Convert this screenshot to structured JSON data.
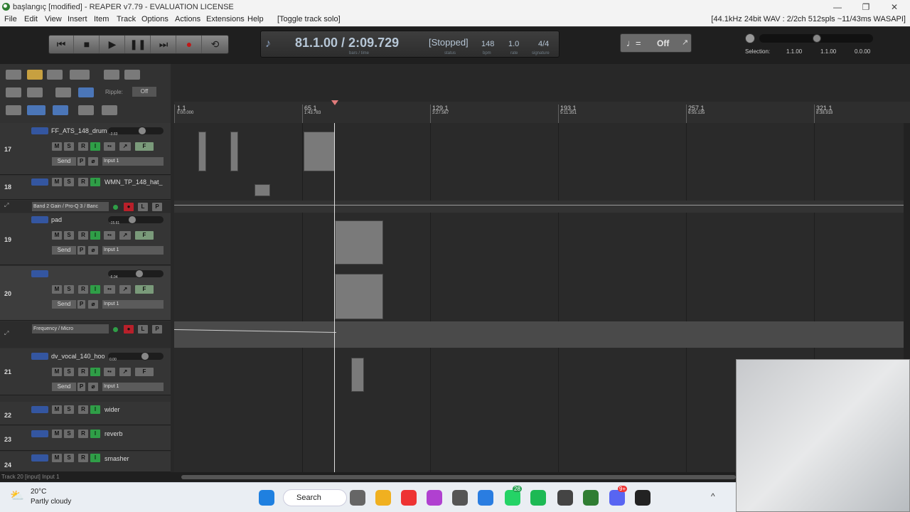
{
  "window": {
    "title": "başlangıç [modified] - REAPER v7.79 - EVALUATION LICENSE"
  },
  "menu": {
    "items": [
      "File",
      "Edit",
      "View",
      "Insert",
      "Item",
      "Track",
      "Options",
      "Actions",
      "Extensions",
      "Help"
    ],
    "action_hint": "[Toggle track solo]",
    "audio_info": "[44.1kHz 24bit WAV : 2/2ch 512spls ~11/43ms WASAPI]"
  },
  "transport": {
    "position": "81.1.00 / 2:09.729",
    "position_sub": "bars / time",
    "status": "[Stopped]",
    "status_sub": "status",
    "bpm": "148",
    "bpm_sub": "bpm",
    "rate": "1.0",
    "rate_sub": "rate",
    "signature": "4/4",
    "signature_sub": "signature",
    "metronome": "Off",
    "selection_label": "Selection:",
    "sel_start": "1.1.00",
    "sel_end": "1.1.00",
    "sel_len": "0.0.00",
    "ripple_label": "Ripple:",
    "ripple_value": "Off"
  },
  "ruler": [
    {
      "bar": "1.1",
      "time": "0:00.000"
    },
    {
      "bar": "65.1",
      "time": "1:43.783"
    },
    {
      "bar": "129.1",
      "time": "3:27.567"
    },
    {
      "bar": "193.1",
      "time": "5:11.351"
    },
    {
      "bar": "257.1",
      "time": "6:55.135"
    },
    {
      "bar": "321.1",
      "time": "8:38.918"
    }
  ],
  "tracks": [
    {
      "num": "17",
      "name": "FF_ATS_148_drum",
      "vol": "-3.63",
      "input": "Input 1"
    },
    {
      "num": "18",
      "name": "WMN_TP_148_hat_"
    },
    {
      "envelope": "Band 2 Gain / Pro-Q 3 / Banc"
    },
    {
      "num": "19",
      "name": "pad",
      "vol": "-15.61",
      "input": "Input 1"
    },
    {
      "num": "20",
      "name": "",
      "vol": "-6.04",
      "input": "Input 1"
    },
    {
      "envelope": "Frequency / Micro"
    },
    {
      "num": "21",
      "name": "dv_vocal_140_hoo",
      "vol": "0.00",
      "input": "Input 1"
    },
    {
      "num": "22",
      "name": "wider"
    },
    {
      "num": "23",
      "name": "reverb"
    },
    {
      "num": "24",
      "name": "smasher"
    }
  ],
  "labels": {
    "mute": "M",
    "solo": "S",
    "route": "R",
    "input_mon": "I",
    "send": "Send",
    "p": "P",
    "fx": "F",
    "env_l": "L",
    "env_p": "P"
  },
  "statusbar": "Track 20 [input] Input 1",
  "taskbar": {
    "temp": "20°C",
    "weather": "Partly cloudy",
    "search": "Search",
    "badge_whatsapp": "28",
    "badge_discord": "9+"
  }
}
